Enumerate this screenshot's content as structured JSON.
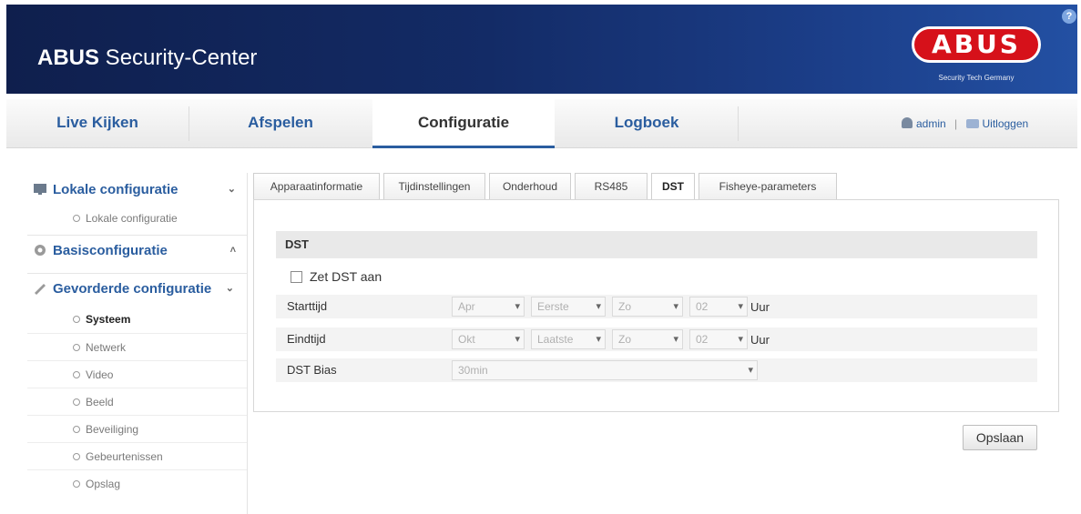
{
  "header": {
    "title_bold": "ABUS",
    "title_rest": " Security-Center",
    "logo_text": "ABUS",
    "logo_tagline": "Security Tech Germany",
    "help_label": "?"
  },
  "topnav": {
    "items": [
      {
        "label": "Live Kijken"
      },
      {
        "label": "Afspelen"
      },
      {
        "label": "Configuratie"
      },
      {
        "label": "Logboek"
      }
    ],
    "user": "admin",
    "separator": "|",
    "logout": "Uitloggen"
  },
  "sidebar": {
    "local": {
      "label": "Lokale configuratie",
      "chevron": "⌄",
      "items": [
        "Lokale configuratie"
      ]
    },
    "basic": {
      "label": "Basisconfiguratie",
      "chevron": "˄"
    },
    "advanced": {
      "label": "Gevorderde configuratie",
      "chevron": "⌄",
      "items": [
        "Systeem",
        "Netwerk",
        "Video",
        "Beeld",
        "Beveiliging",
        "Gebeurtenissen",
        "Opslag"
      ]
    }
  },
  "tabs": [
    "Apparaatinformatie",
    "Tijdinstellingen",
    "Onderhoud",
    "RS485",
    "DST",
    "Fisheye-parameters"
  ],
  "form": {
    "section_title": "DST",
    "enable_label": "Zet DST aan",
    "start_label": "Starttijd",
    "end_label": "Eindtijd",
    "bias_label": "DST Bias",
    "start": {
      "month": "Apr",
      "week": "Eerste",
      "day": "Zo",
      "hour": "02"
    },
    "end": {
      "month": "Okt",
      "week": "Laatste",
      "day": "Zo",
      "hour": "02"
    },
    "hour_unit": "Uur",
    "bias_value": "30min"
  },
  "save_label": "Opslaan",
  "colors": {
    "header_dark": "#0f1f4d",
    "header_light": "#2350a3",
    "link_blue": "#2a5d9f",
    "logo_red": "#d6111a"
  }
}
